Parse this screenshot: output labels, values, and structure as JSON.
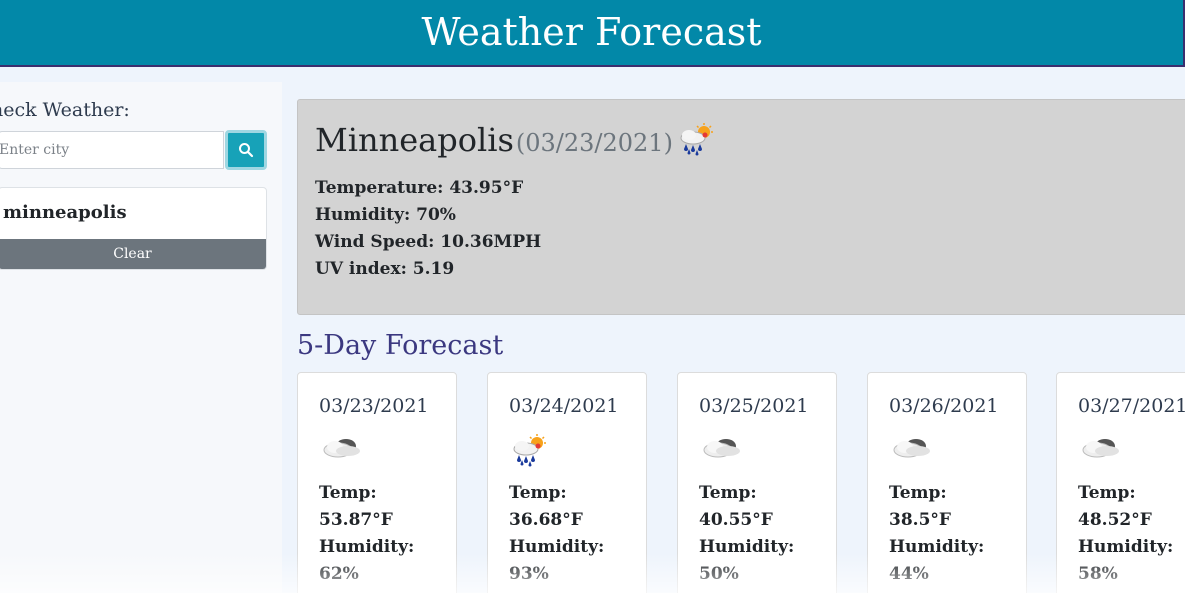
{
  "header": {
    "title": "Weather Forecast"
  },
  "sidebar": {
    "label": "heck Weather:",
    "search_placeholder": "Enter city",
    "history": [
      "minneapolis"
    ],
    "clear_label": "Clear"
  },
  "current": {
    "city": "Minneapolis",
    "date": "(03/23/2021)",
    "icon": "rain-sun-icon",
    "temperature": "Temperature: 43.95°F",
    "humidity": "Humidity: 70%",
    "wind": "Wind Speed: 10.36MPH",
    "uv": "UV index: 5.19"
  },
  "forecast": {
    "title": "5-Day Forecast",
    "temp_label": "Temp:",
    "humidity_label": "Humidity:",
    "days": [
      {
        "date": "03/23/2021",
        "icon": "cloud-icon",
        "temp": "53.87°F",
        "humidity": "62%"
      },
      {
        "date": "03/24/2021",
        "icon": "rain-sun-icon",
        "temp": "36.68°F",
        "humidity": "93%"
      },
      {
        "date": "03/25/2021",
        "icon": "cloud-icon",
        "temp": "40.55°F",
        "humidity": "50%"
      },
      {
        "date": "03/26/2021",
        "icon": "cloud-icon",
        "temp": "38.5°F",
        "humidity": "44%"
      },
      {
        "date": "03/27/2021",
        "icon": "cloud-icon",
        "temp": "48.52°F",
        "humidity": "58%"
      }
    ]
  }
}
